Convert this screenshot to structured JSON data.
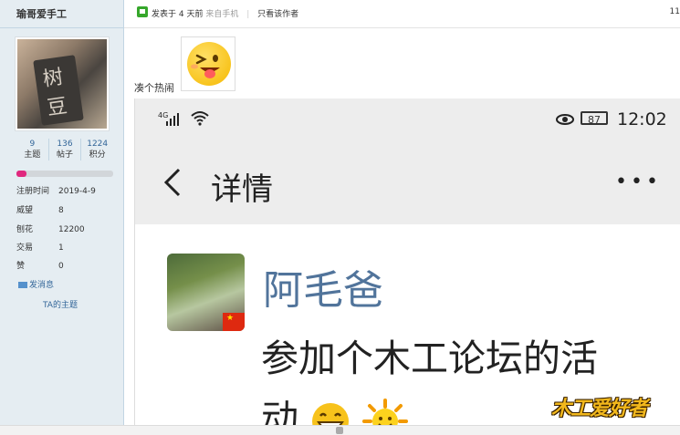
{
  "author": {
    "username": "瑜哥爱手工",
    "stats": [
      {
        "value": "9",
        "label": "主题"
      },
      {
        "value": "136",
        "label": "帖子"
      },
      {
        "value": "1224",
        "label": "积分"
      }
    ],
    "level_progress": 0.1,
    "info": [
      {
        "key": "注册时间",
        "value": "2019-4-9"
      },
      {
        "key": "威望",
        "value": "8"
      },
      {
        "key": "刨花",
        "value": "12200"
      },
      {
        "key": "交易",
        "value": "1"
      },
      {
        "key": "赞",
        "value": "0"
      }
    ],
    "send_message": "发消息",
    "ta_topics": "TA的主题"
  },
  "post_header": {
    "posted_prefix": "发表于",
    "posted_time": "4 天前",
    "source": "来自手机",
    "only_author": "只看该作者",
    "floor_number": "11"
  },
  "post": {
    "text": "凑个热闹"
  },
  "screenshot": {
    "network_type": "4G",
    "battery": "87",
    "time": "12:02",
    "title": "详情",
    "contact_name": "阿毛爸",
    "message_line1": "参加个木工论坛的活",
    "message_line2": "动",
    "watermark": "木工爱好者"
  },
  "colors": {
    "sidebar_bg": "#e5edf2",
    "link": "#336699",
    "progress": "#e0287e",
    "contact_name": "#51749b"
  }
}
